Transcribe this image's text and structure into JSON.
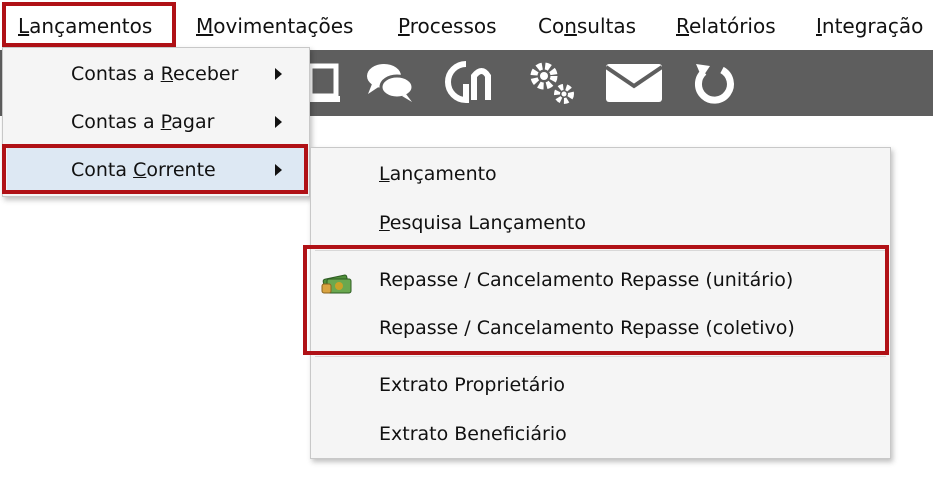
{
  "menubar": {
    "items": [
      {
        "before": "",
        "accel": "L",
        "after": "ançamentos"
      },
      {
        "before": "",
        "accel": "M",
        "after": "ovimentações"
      },
      {
        "before": "",
        "accel": "P",
        "after": "rocessos"
      },
      {
        "before": "Co",
        "accel": "n",
        "after": "sultas"
      },
      {
        "before": "",
        "accel": "R",
        "after": "elatórios"
      },
      {
        "before": "",
        "accel": "I",
        "after": "ntegração"
      }
    ]
  },
  "toolbar": {
    "icons": [
      "document-icon",
      "chat-icon",
      "logo-icon",
      "gears-icon",
      "mail-icon",
      "refresh-icon"
    ],
    "background": "#5e5e5e"
  },
  "lancamentos_menu": {
    "items": [
      {
        "before": "Contas a ",
        "accel": "R",
        "after": "eceber"
      },
      {
        "before": "Contas a ",
        "accel": "P",
        "after": "agar"
      },
      {
        "before": "Conta ",
        "accel": "C",
        "after": "orrente"
      }
    ]
  },
  "conta_corrente_menu": {
    "items": [
      {
        "before": "",
        "accel": "L",
        "after": "ançamento"
      },
      {
        "before": "",
        "accel": "P",
        "after": "esquisa Lançamento"
      },
      {
        "label": "Repasse / Cancelamento Repasse (unitário)"
      },
      {
        "label": "Repasse / Cancelamento Repasse (coletivo)"
      },
      {
        "label": "Extrato Proprietário"
      },
      {
        "label": "Extrato Beneficiário"
      }
    ]
  },
  "colors": {
    "highlight": "#b01116",
    "selected": "#dde8f3",
    "menu_bg": "#f5f5f5"
  }
}
